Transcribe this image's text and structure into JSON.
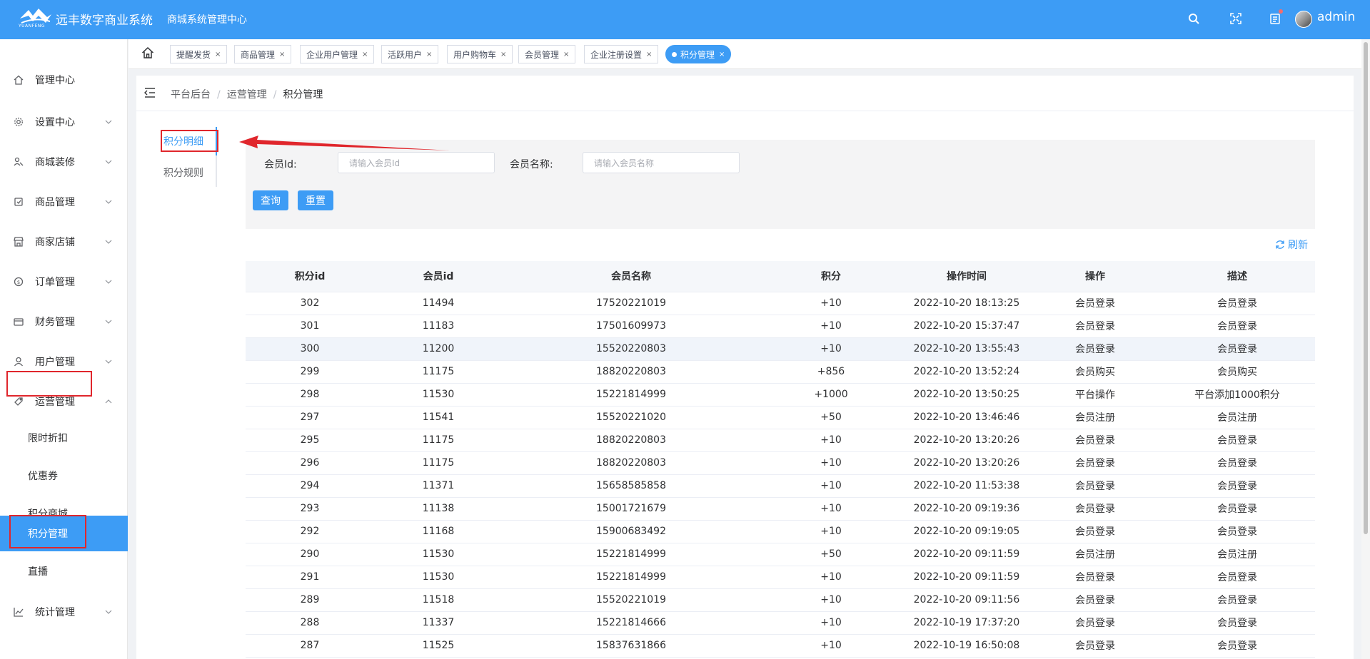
{
  "header": {
    "logo_text": "YUANFENG",
    "app_name": "远丰数字商业系统",
    "center_title": "商城系统管理中心",
    "username": "admin",
    "icons": [
      "search-icon",
      "fullscreen-icon",
      "notification-icon"
    ]
  },
  "sidebar": {
    "items": [
      {
        "label": "管理中心",
        "icon": "home-icon"
      },
      {
        "label": "设置中心",
        "icon": "gear-icon"
      },
      {
        "label": "商城装修",
        "icon": "decoration-icon"
      },
      {
        "label": "商品管理",
        "icon": "goods-icon"
      },
      {
        "label": "商家店铺",
        "icon": "store-icon"
      },
      {
        "label": "订单管理",
        "icon": "order-icon"
      },
      {
        "label": "财务管理",
        "icon": "finance-icon"
      },
      {
        "label": "用户管理",
        "icon": "user-icon"
      },
      {
        "label": "运营管理",
        "icon": "operation-icon"
      },
      {
        "label": "统计管理",
        "icon": "stats-icon"
      }
    ],
    "sub_items": [
      {
        "label": "限时折扣"
      },
      {
        "label": "优惠券"
      },
      {
        "label": "积分商城"
      },
      {
        "label": "积分管理"
      },
      {
        "label": "直播"
      }
    ]
  },
  "tabs": [
    {
      "label": "提醒发货"
    },
    {
      "label": "商品管理"
    },
    {
      "label": "企业用户管理"
    },
    {
      "label": "活跃用户"
    },
    {
      "label": "用户购物车"
    },
    {
      "label": "会员管理"
    },
    {
      "label": "企业注册设置"
    },
    {
      "label": "积分管理",
      "active": true
    }
  ],
  "breadcrumb": [
    "平台后台",
    "运营管理",
    "积分管理"
  ],
  "vtabs": [
    "积分明细",
    "积分规则"
  ],
  "search": {
    "member_id_label": "会员Id:",
    "member_id_placeholder": "请输入会员Id",
    "member_name_label": "会员名称:",
    "member_name_placeholder": "请输入会员名称",
    "query_label": "查询",
    "reset_label": "重置"
  },
  "refresh_label": "刷新",
  "table": {
    "columns": [
      "积分id",
      "会员id",
      "会员名称",
      "积分",
      "操作时间",
      "操作",
      "描述"
    ],
    "rows": [
      [
        "302",
        "11494",
        "17520221019",
        "+10",
        "2022-10-20 18:13:25",
        "会员登录",
        "会员登录"
      ],
      [
        "301",
        "11183",
        "17501609973",
        "+10",
        "2022-10-20 15:37:47",
        "会员登录",
        "会员登录"
      ],
      [
        "300",
        "11200",
        "15520220803",
        "+10",
        "2022-10-20 13:55:43",
        "会员登录",
        "会员登录"
      ],
      [
        "299",
        "11175",
        "18820220803",
        "+856",
        "2022-10-20 13:52:24",
        "会员购买",
        "会员购买"
      ],
      [
        "298",
        "11530",
        "15221814999",
        "+1000",
        "2022-10-20 13:50:25",
        "平台操作",
        "平台添加1000积分"
      ],
      [
        "297",
        "11541",
        "15520221020",
        "+50",
        "2022-10-20 13:46:46",
        "会员注册",
        "会员注册"
      ],
      [
        "295",
        "11175",
        "18820220803",
        "+10",
        "2022-10-20 13:20:26",
        "会员登录",
        "会员登录"
      ],
      [
        "296",
        "11175",
        "18820220803",
        "+10",
        "2022-10-20 13:20:26",
        "会员登录",
        "会员登录"
      ],
      [
        "294",
        "11371",
        "15658585858",
        "+10",
        "2022-10-20 11:53:38",
        "会员登录",
        "会员登录"
      ],
      [
        "293",
        "11138",
        "15001721679",
        "+10",
        "2022-10-20 09:19:36",
        "会员登录",
        "会员登录"
      ],
      [
        "292",
        "11168",
        "15900683492",
        "+10",
        "2022-10-20 09:19:05",
        "会员登录",
        "会员登录"
      ],
      [
        "290",
        "11530",
        "15221814999",
        "+50",
        "2022-10-20 09:11:59",
        "会员注册",
        "会员注册"
      ],
      [
        "291",
        "11530",
        "15221814999",
        "+10",
        "2022-10-20 09:11:59",
        "会员登录",
        "会员登录"
      ],
      [
        "289",
        "11518",
        "15520221019",
        "+10",
        "2022-10-20 09:11:56",
        "会员登录",
        "会员登录"
      ],
      [
        "288",
        "11337",
        "15221814666",
        "+10",
        "2022-10-19 17:37:20",
        "会员登录",
        "会员登录"
      ],
      [
        "287",
        "11525",
        "15837631866",
        "+10",
        "2022-10-19 16:50:08",
        "会员登录",
        "会员登录"
      ]
    ]
  },
  "colors": {
    "primary": "#3d9cf5",
    "annotation": "#e0262c"
  }
}
